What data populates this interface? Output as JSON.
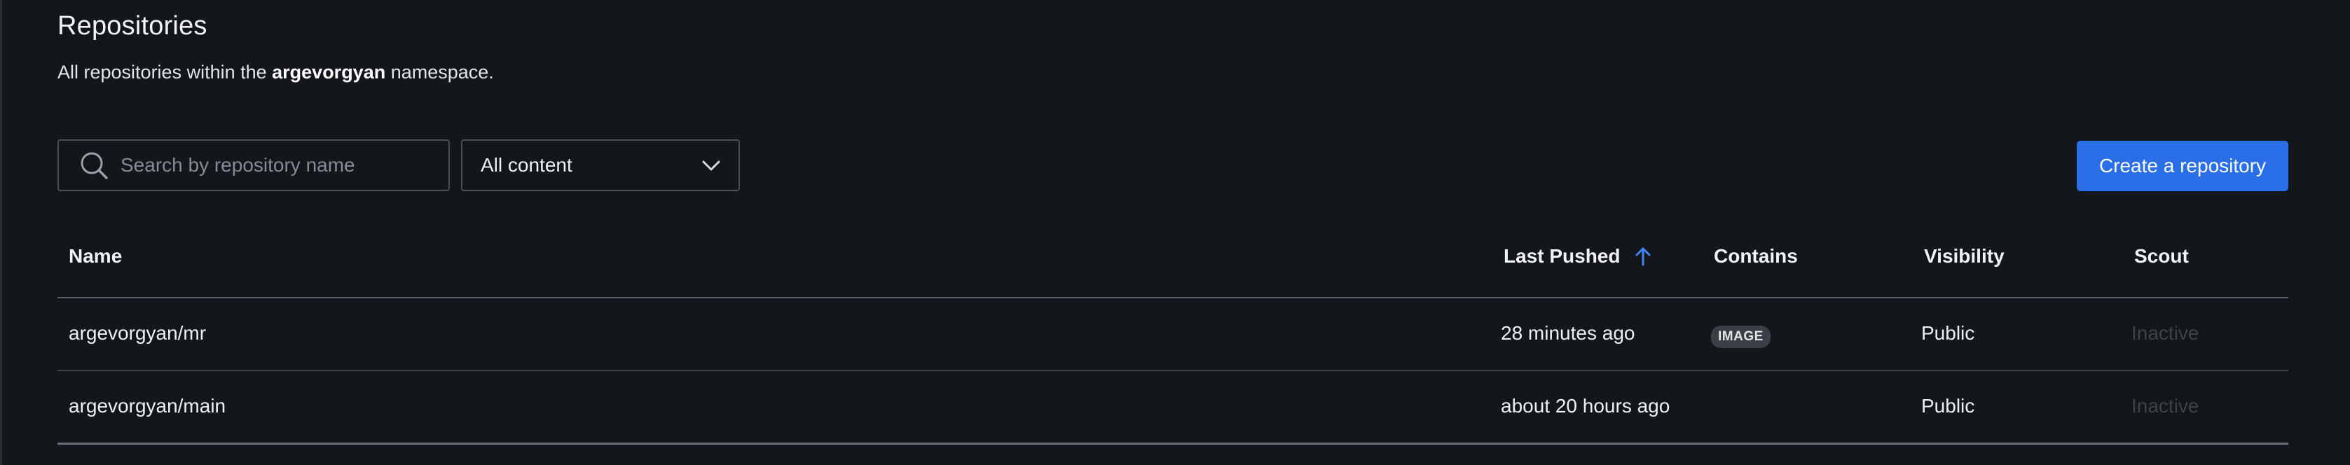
{
  "page": {
    "title": "Repositories",
    "subtitle_prefix": "All repositories within the ",
    "namespace": "argevorgyan",
    "subtitle_suffix": " namespace."
  },
  "toolbar": {
    "search_placeholder": "Search by repository name",
    "search_value": "",
    "content_filter": "All content",
    "create_label": "Create a repository"
  },
  "table": {
    "columns": {
      "name": "Name",
      "last_pushed": "Last Pushed",
      "contains": "Contains",
      "visibility": "Visibility",
      "scout": "Scout"
    },
    "sort": {
      "column": "last_pushed",
      "direction": "ascending"
    },
    "rows": [
      {
        "name": "argevorgyan/mr",
        "last_pushed": "28 minutes ago",
        "contains": "IMAGE",
        "visibility": "Public",
        "scout": "Inactive"
      },
      {
        "name": "argevorgyan/main",
        "last_pushed": "about 20 hours ago",
        "contains": "",
        "visibility": "Public",
        "scout": "Inactive"
      }
    ]
  },
  "colors": {
    "background": "#13161b",
    "accent": "#2a6fe8",
    "sort_arrow": "#3f86f5",
    "badge_bg": "#3b3f45",
    "inactive_text": "#3e434a"
  },
  "icons": {
    "search": "search-icon",
    "dropdown": "chevron-down-icon",
    "sort": "arrow-up-icon"
  }
}
